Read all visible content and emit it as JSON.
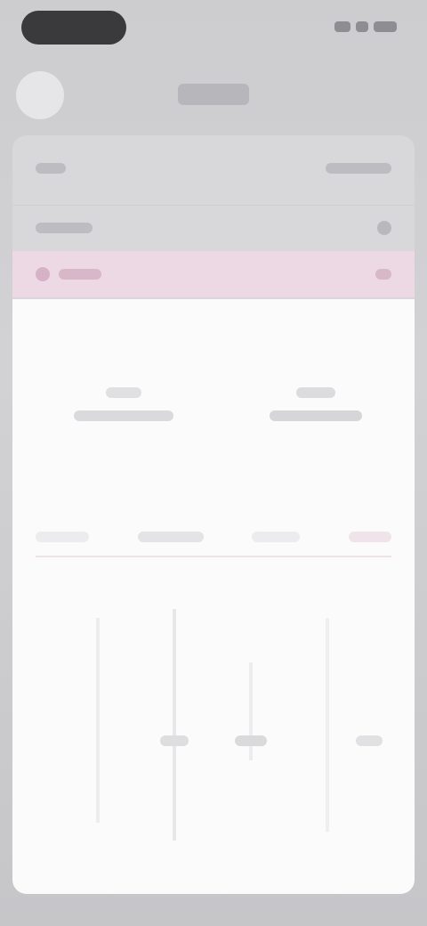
{
  "status_bar": {},
  "nav": {},
  "header_rows": {},
  "summary": {},
  "tabs": [],
  "chart_area": {},
  "colors": {
    "background": "#cdcdd0",
    "panel": "#fbfbfb",
    "highlight_row": "#ecd9e4"
  }
}
